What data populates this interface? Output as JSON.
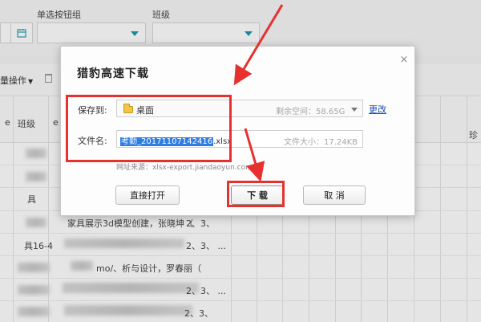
{
  "filters": {
    "radio_group_label": "单选按钮组",
    "class_label": "班级"
  },
  "toolbar": {
    "batch_label": "量操作"
  },
  "table": {
    "header_class": "班级",
    "header_small": "e",
    "header_right": "珍",
    "row_labels": [
      "具",
      "具16-4"
    ],
    "row_texts": [
      "家具展示3d模型创建，张晓坤（",
      "2、3、",
      "2、3、 ...",
      "2、3、 ...",
      "2、3、",
      "2、3、 ..."
    ],
    "partial_texts": [
      "mo/、析与设计，罗春丽（",
      "2、3、 ..."
    ]
  },
  "dialog": {
    "title": "猎豹高速下载",
    "close_glyph": "×",
    "save_to_label": "保存到:",
    "save_to_value": "桌面",
    "free_space": "剩余空间：58.65G",
    "change_link": "更改",
    "filename_label": "文件名:",
    "filename_selected": "考勤_20171107142416",
    "filename_ext": ".xlsx",
    "file_size": "文件大小：17.24KB",
    "source_url": "网址来源：xlsx-export.jiandaoyun.com",
    "open_button": "直接打开",
    "download_button": "下  载",
    "cancel_button": "取  消"
  },
  "colors": {
    "annotation_red": "#e6312f",
    "accent_teal": "#1e9aa6",
    "selection_blue": "#2f7de1"
  }
}
